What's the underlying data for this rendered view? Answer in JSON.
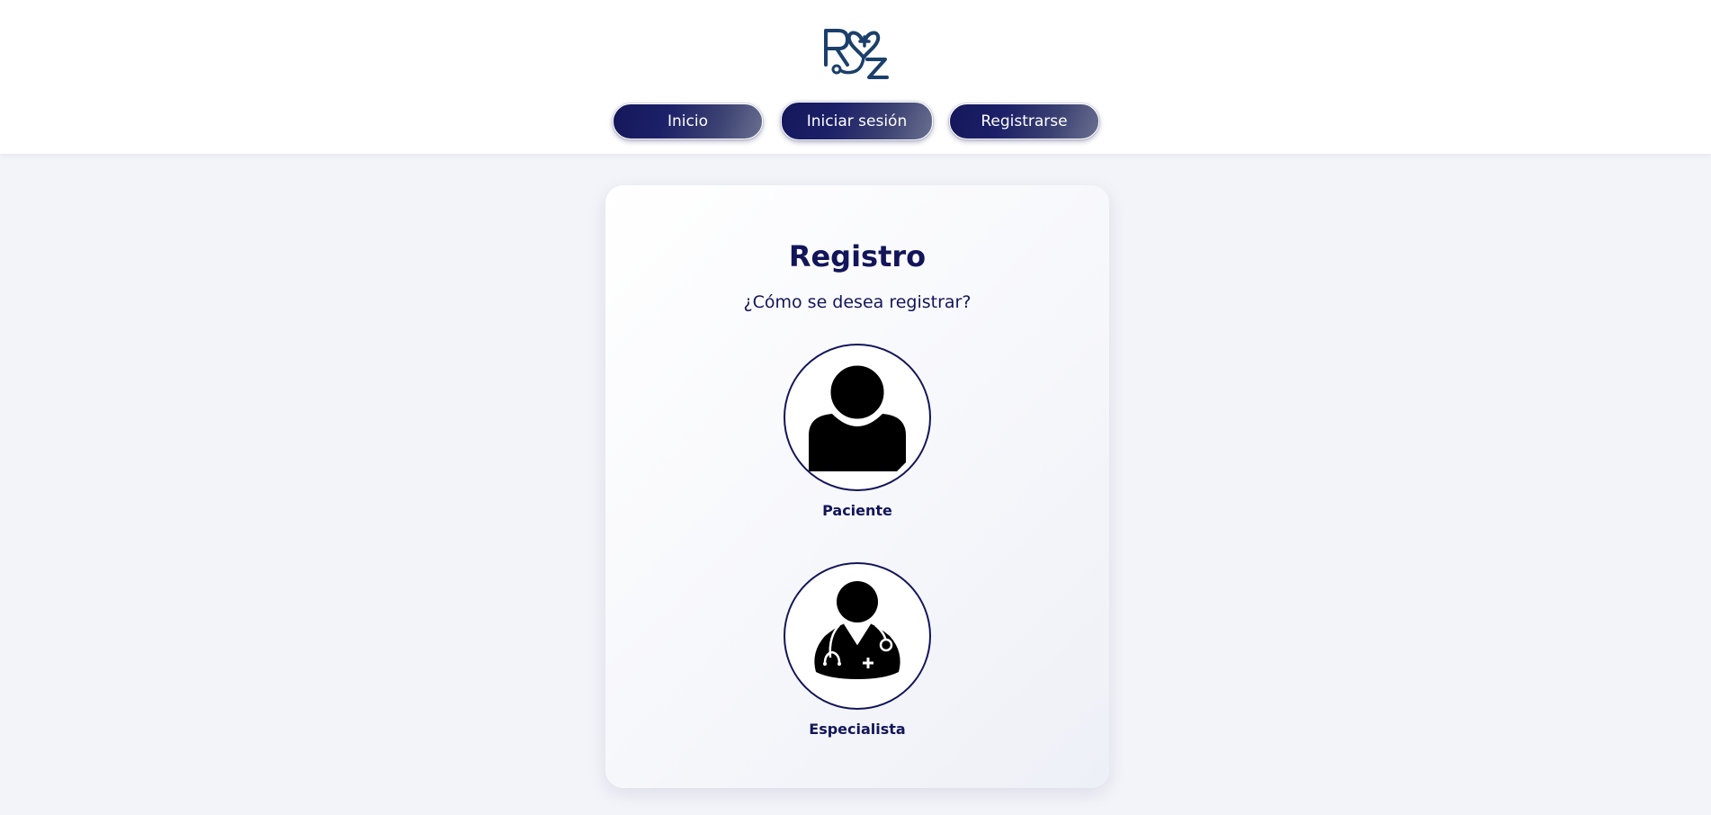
{
  "header": {
    "logo_icon": "rz-stethoscope-heart-logo",
    "nav": {
      "home_label": "Inicio",
      "login_label": "Iniciar sesión",
      "register_label": "Registrarse"
    }
  },
  "card": {
    "title": "Registro",
    "subtitle": "¿Cómo se desea registrar?",
    "options": [
      {
        "label": "Paciente",
        "icon": "patient-user-icon"
      },
      {
        "label": "Especialista",
        "icon": "doctor-specialist-icon"
      }
    ]
  },
  "colors": {
    "primary": "#13155a",
    "background": "#f3f4f9",
    "header_bg": "#ffffff",
    "button_gradient_start": "#14175a",
    "button_gradient_end": "#6a7090"
  }
}
